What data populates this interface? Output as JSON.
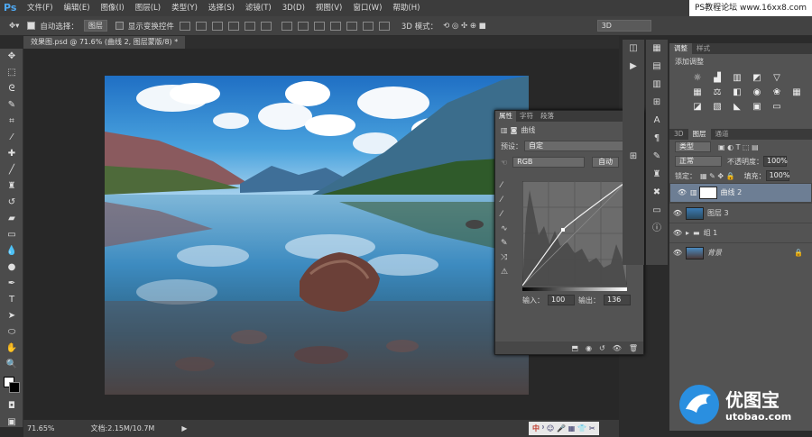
{
  "menubar": {
    "logo": "Ps",
    "items": [
      "文件(F)",
      "编辑(E)",
      "图像(I)",
      "图层(L)",
      "类型(Y)",
      "选择(S)",
      "滤镜(T)",
      "3D(D)",
      "视图(V)",
      "窗口(W)",
      "帮助(H)"
    ],
    "watermark": "PS教程论坛 www.16xx8.com"
  },
  "optbar": {
    "auto_select_label": "自动选择：",
    "auto_select_value": "图层",
    "show_transform_label": "显示变换控件",
    "mode_3d_label": "3D 模式：",
    "workspace_value": "3D"
  },
  "document": {
    "tab_title": "效果图.psd @ 71.6% (曲线 2, 图层蒙版/8) *",
    "zoom": "71.65%",
    "doc_size": "文档:2.15M/10.7M"
  },
  "properties_panel": {
    "tabs": [
      "属性",
      "字符",
      "段落"
    ],
    "title": "曲线",
    "preset_label": "预设：",
    "preset_value": "自定",
    "channel_value": "RGB",
    "auto_button": "自动",
    "input_label": "输入：",
    "input_value": "100",
    "output_label": "输出：",
    "output_value": "136"
  },
  "adjustments_panel": {
    "tabs": [
      "调整",
      "样式"
    ],
    "title": "添加调整"
  },
  "layers_panel": {
    "tabs": [
      "3D",
      "图层",
      "通道"
    ],
    "filter_kind": "类型",
    "blend_mode": "正常",
    "opacity_label": "不透明度：",
    "opacity_value": "100%",
    "lock_label": "锁定：",
    "fill_label": "填充：",
    "fill_value": "100%",
    "layers": [
      {
        "name": "曲线 2",
        "type": "adjustment"
      },
      {
        "name": "图层 3",
        "type": "image"
      },
      {
        "name": "组 1",
        "type": "group"
      },
      {
        "name": "背景",
        "type": "background"
      }
    ]
  },
  "ime_bar": {
    "label": "中"
  },
  "brand_logo": {
    "title": "优图宝",
    "url": "utobao.com"
  }
}
